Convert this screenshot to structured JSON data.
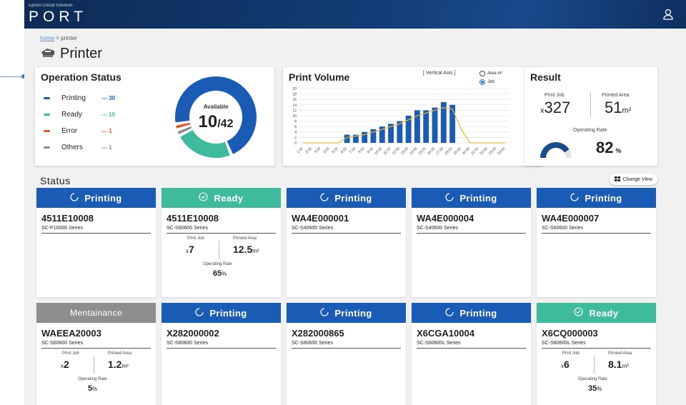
{
  "header": {
    "brand_small": "Epson Cloud Solution",
    "brand_main": "PORT",
    "user_icon": "user-icon"
  },
  "breadcrumb": {
    "home": "home",
    "sep": " > ",
    "current": "printer"
  },
  "page": {
    "title": "Printer",
    "icon": "printer-icon"
  },
  "operation_status": {
    "title": "Operation Status",
    "items": [
      {
        "label": "Printing",
        "count": "--- 30",
        "color": "#1a5bb5"
      },
      {
        "label": "Ready",
        "count": "--- 10",
        "color": "#3dbb9c"
      },
      {
        "label": "Error",
        "count": "--- 1",
        "color": "#e8542a"
      },
      {
        "label": "Others",
        "count": "--- 1",
        "color": "#888888"
      }
    ],
    "available_label": "Available",
    "available_value": "10",
    "available_total": "/42",
    "donut": [
      {
        "name": "Printing",
        "value": 30,
        "color": "#1a5bb5"
      },
      {
        "name": "Ready",
        "value": 10,
        "color": "#3dbb9c"
      },
      {
        "name": "Others",
        "value": 1,
        "color": "#888888"
      },
      {
        "name": "Error",
        "value": 1,
        "color": "#e8542a"
      }
    ]
  },
  "print_volume": {
    "title": "Print Volume",
    "axis_note": "[ Vertical Axis ]",
    "radio_area": "Area m²",
    "radio_job": "Job",
    "selected": "Job"
  },
  "chart_data": {
    "type": "bar",
    "categories": [
      "1:00",
      "2:00",
      "3:00",
      "4:00",
      "5:00",
      "6:00",
      "7:00",
      "8:00",
      "9:00",
      "10:00",
      "11:00",
      "12:00",
      "13:00",
      "14:00",
      "15:00",
      "16:00",
      "17:00",
      "18:00",
      "19:00",
      "20:00",
      "21:00",
      "22:00",
      "23:00",
      "24:00"
    ],
    "series": [
      {
        "values": [
          0,
          0,
          0,
          0,
          0,
          3,
          3,
          4,
          5,
          6,
          7,
          8,
          10,
          12,
          12,
          13,
          15,
          14,
          0,
          0,
          0,
          0,
          0,
          0
        ],
        "color": "#1a5bb5"
      },
      {
        "values": [
          0,
          0,
          0,
          0,
          0,
          2,
          2.5,
          3,
          4,
          5,
          6,
          7,
          8.5,
          10,
          11,
          12,
          13,
          12.5,
          5,
          0,
          0,
          0,
          0,
          0
        ],
        "color": "#f2b833"
      }
    ],
    "yticks": [
      0,
      2,
      4,
      6,
      8,
      10,
      12,
      14,
      16,
      18,
      20
    ],
    "ylim": [
      0,
      20
    ],
    "grid": true
  },
  "result": {
    "title": "Result",
    "print_job_label": "Print Job",
    "print_job_prefix": "x",
    "print_job_value": "327",
    "printed_area_label": "Printed Area",
    "printed_area_value": "51",
    "printed_area_unit": "m²",
    "operating_rate_label": "Operating Rate",
    "operating_rate_value": "82",
    "operating_rate_unit": "%",
    "gauge_fraction": 0.82
  },
  "status": {
    "title": "Status",
    "change_view": "Change View",
    "printers": [
      {
        "state": "printing",
        "state_label": "Printing",
        "id": "4511E10008",
        "series": "SC-P10000 Series"
      },
      {
        "state": "ready",
        "state_label": "Ready",
        "id": "4511E10008",
        "series": "SC-S80600 Series",
        "stats": {
          "job_label": "Print Job",
          "job_prefix": "x",
          "job": "7",
          "area_label": "Printed Area",
          "area": "12.5",
          "area_unit": "m²",
          "rate_label": "Operating Rate",
          "rate": "65",
          "rate_unit": "%"
        }
      },
      {
        "state": "printing",
        "state_label": "Printing",
        "id": "WA4E000001",
        "series": "SC-S40600 Series"
      },
      {
        "state": "printing",
        "state_label": "Printing",
        "id": "WA4E000004",
        "series": "SC-S40600 Series"
      },
      {
        "state": "printing",
        "state_label": "Printing",
        "id": "WA4E000007",
        "series": "SC-S60600 Series"
      },
      {
        "state": "maint",
        "state_label": "Mentainance",
        "id": "WAEEA20003",
        "series": "SC-S60600 Series",
        "stats": {
          "job_label": "Print Job",
          "job_prefix": "x",
          "job": "2",
          "area_label": "Printed Area",
          "area": "1.2",
          "area_unit": "m²",
          "rate_label": "Operating Rate",
          "rate": "5",
          "rate_unit": "%"
        }
      },
      {
        "state": "printing",
        "state_label": "Printing",
        "id": "X282000002",
        "series": "SC-S80600 Series"
      },
      {
        "state": "printing",
        "state_label": "Printing",
        "id": "X282000865",
        "series": "SC-S80600 Series"
      },
      {
        "state": "printing",
        "state_label": "Printing",
        "id": "X6CGA10004",
        "series": "SC-S60600L Series"
      },
      {
        "state": "ready",
        "state_label": "Ready",
        "id": "X6CQ000003",
        "series": "SC-S80600L Series",
        "stats": {
          "job_label": "Print Job",
          "job_prefix": "x",
          "job": "6",
          "area_label": "Printed Area",
          "area": "8.1",
          "area_unit": "m²",
          "rate_label": "Operating Rate",
          "rate": "35",
          "rate_unit": "%"
        }
      }
    ]
  }
}
